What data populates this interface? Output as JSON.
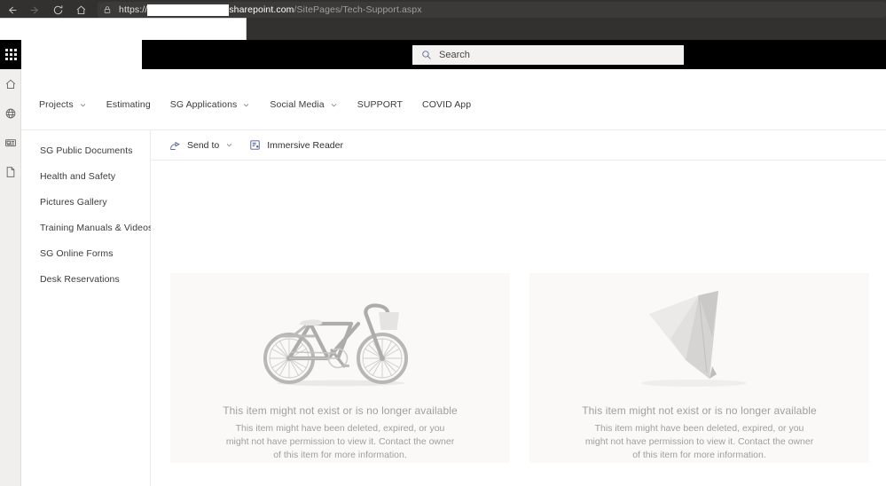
{
  "browser": {
    "back_label": "Back",
    "forward_label": "Forward",
    "refresh_label": "Refresh",
    "home_label": "Home",
    "lock_icon": "lock-icon",
    "url_scheme": "https://",
    "url_redacted": "",
    "url_domain": "sharepoint.com",
    "url_path": "/SitePages/Tech-Support.aspx"
  },
  "suite": {
    "waffle_label": "App launcher",
    "search_placeholder": "Search",
    "search_icon": "search-icon"
  },
  "rail": {
    "items": [
      {
        "name": "home-icon",
        "label": "Home"
      },
      {
        "name": "globe-icon",
        "label": "Sites"
      },
      {
        "name": "news-icon",
        "label": "News"
      },
      {
        "name": "page-icon",
        "label": "Files"
      }
    ]
  },
  "topnav": {
    "items": [
      {
        "label": "Projects",
        "has_chevron": true
      },
      {
        "label": "Estimating",
        "has_chevron": false
      },
      {
        "label": "SG Applications",
        "has_chevron": true
      },
      {
        "label": "Social Media",
        "has_chevron": true
      },
      {
        "label": "SUPPORT",
        "has_chevron": false
      },
      {
        "label": "COVID App",
        "has_chevron": false
      }
    ]
  },
  "quicklaunch": {
    "items": [
      {
        "label": "SG Public Documents"
      },
      {
        "label": "Health and Safety"
      },
      {
        "label": "Pictures Gallery"
      },
      {
        "label": "Training Manuals & Videos"
      },
      {
        "label": "SG Online Forms"
      },
      {
        "label": "Desk Reservations"
      }
    ]
  },
  "commandbar": {
    "send_to_label": "Send to",
    "send_to_icon": "send-to-icon",
    "immersive_reader_label": "Immersive Reader",
    "immersive_reader_icon": "immersive-reader-icon"
  },
  "cards": [
    {
      "art": "bicycle-illustration",
      "title": "This item might not exist or is no longer available",
      "body": "This item might have been deleted, expired, or you might not have permission to view it. Contact the owner of this item for more information."
    },
    {
      "art": "paper-airplane-illustration",
      "title": "This item might not exist or is no longer available",
      "body": "This item might have been deleted, expired, or you might not have permission to view it. Contact the owner of this item for more information."
    }
  ],
  "colors": {
    "chrome_bg": "#323130",
    "suite_bar_bg": "#000000",
    "rail_bg": "#f0efee",
    "card_bg": "#faf9f8",
    "accent_icon": "#4b5b8c",
    "text_primary": "#3b3a39",
    "text_muted": "#a19f9d"
  }
}
